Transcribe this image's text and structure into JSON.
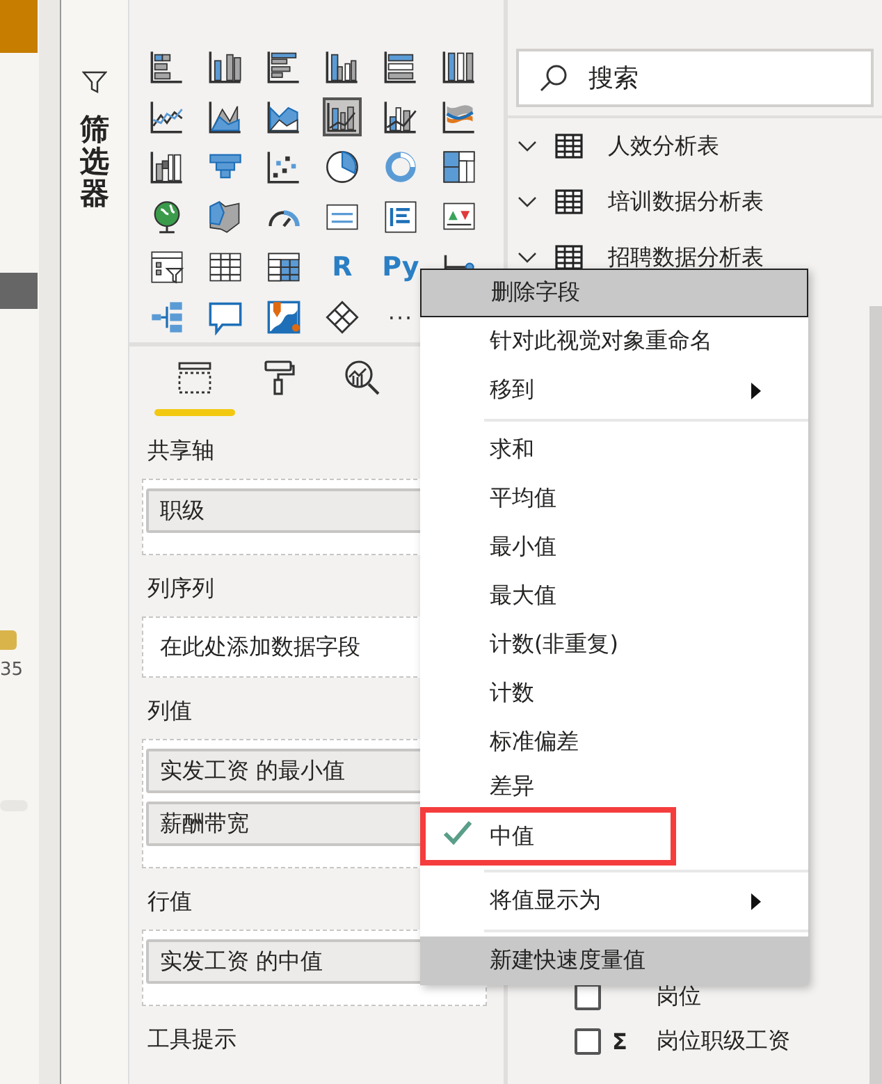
{
  "report_canvas": {
    "labels": [
      "35"
    ]
  },
  "filters_pane": {
    "title": "筛选器"
  },
  "visualizations": {
    "icons": [
      {
        "kind": "bar-stacked",
        "selected": false
      },
      {
        "kind": "column-stacked",
        "selected": false
      },
      {
        "kind": "bar-clustered",
        "selected": false
      },
      {
        "kind": "column-clustered",
        "selected": false
      },
      {
        "kind": "bar-100",
        "selected": false
      },
      {
        "kind": "column-100",
        "selected": false
      },
      {
        "kind": "line",
        "selected": false
      },
      {
        "kind": "area",
        "selected": false
      },
      {
        "kind": "area-stacked",
        "selected": false
      },
      {
        "kind": "line-column",
        "selected": true
      },
      {
        "kind": "line-column-clustered",
        "selected": false
      },
      {
        "kind": "ribbon",
        "selected": false
      },
      {
        "kind": "waterfall",
        "selected": false
      },
      {
        "kind": "funnel",
        "selected": false
      },
      {
        "kind": "scatter",
        "selected": false
      },
      {
        "kind": "pie",
        "selected": false
      },
      {
        "kind": "donut",
        "selected": false
      },
      {
        "kind": "treemap",
        "selected": false
      },
      {
        "kind": "globe",
        "selected": false
      },
      {
        "kind": "filled-map",
        "selected": false
      },
      {
        "kind": "gauge",
        "selected": false
      },
      {
        "kind": "card",
        "selected": false
      },
      {
        "kind": "multirow-card",
        "selected": false
      },
      {
        "kind": "kpi",
        "selected": false
      },
      {
        "kind": "slicer",
        "selected": false
      },
      {
        "kind": "table",
        "selected": false
      },
      {
        "kind": "matrix",
        "selected": false
      },
      {
        "kind": "text",
        "text": "R",
        "selected": false
      },
      {
        "kind": "text",
        "text": "Py",
        "selected": false
      },
      {
        "kind": "key-influencers",
        "selected": false
      },
      {
        "kind": "decomposition-tree",
        "selected": false
      },
      {
        "kind": "qa",
        "selected": false
      },
      {
        "kind": "arcgis",
        "selected": false
      },
      {
        "kind": "power-apps",
        "selected": false
      },
      {
        "kind": "more",
        "text": "···",
        "selected": false
      }
    ],
    "tabs": [
      {
        "kind": "fields",
        "selected": true
      },
      {
        "kind": "format",
        "selected": false
      },
      {
        "kind": "analytics",
        "selected": false
      }
    ],
    "wells": [
      {
        "label": "共享轴",
        "fields": [
          "职级"
        ]
      },
      {
        "label": "列序列",
        "placeholder": "在此处添加数据字段"
      },
      {
        "label": "列值",
        "fields": [
          "实发工资 的最小值",
          "薪酬带宽"
        ]
      },
      {
        "label": "行值",
        "fields": [
          "实发工资 的中值"
        ]
      },
      {
        "label": "工具提示"
      }
    ]
  },
  "fields_pane": {
    "search": {
      "placeholder": "搜索"
    },
    "tables": [
      {
        "name": "人效分析表",
        "expanded": true
      },
      {
        "name": "培训数据分析表",
        "expanded": true
      },
      {
        "name": "招聘数据分析表",
        "expanded": true
      }
    ],
    "fields": [
      {
        "name": "岗位",
        "kind": "column",
        "checked": false
      },
      {
        "name": "岗位职级工资",
        "kind": "measure",
        "symbol": "Σ",
        "checked": false
      }
    ]
  },
  "context_menu": {
    "items": [
      {
        "kind": "action",
        "label": "删除字段",
        "highlighted": true,
        "focused": true
      },
      {
        "kind": "action",
        "label": "针对此视觉对象重命名",
        "highlighted": false,
        "focused": false
      },
      {
        "kind": "submenu",
        "label": "移到",
        "highlighted": false,
        "focused": false
      },
      {
        "kind": "separator"
      },
      {
        "kind": "aggregate",
        "label": "求和",
        "checked": false,
        "outlined": false
      },
      {
        "kind": "aggregate",
        "label": "平均值",
        "checked": false,
        "outlined": false
      },
      {
        "kind": "aggregate",
        "label": "最小值",
        "checked": false,
        "outlined": false
      },
      {
        "kind": "aggregate",
        "label": "最大值",
        "checked": false,
        "outlined": false
      },
      {
        "kind": "aggregate",
        "label": "计数(非重复)",
        "checked": false,
        "outlined": false
      },
      {
        "kind": "aggregate",
        "label": "计数",
        "checked": false,
        "outlined": false
      },
      {
        "kind": "aggregate",
        "label": "标准偏差",
        "checked": false,
        "outlined": false
      },
      {
        "kind": "aggregate",
        "label": "差异",
        "checked": false,
        "outlined": false
      },
      {
        "kind": "aggregate",
        "label": "中值",
        "checked": true,
        "outlined": true
      },
      {
        "kind": "separator"
      },
      {
        "kind": "submenu",
        "label": "将值显示为",
        "highlighted": false,
        "focused": false
      },
      {
        "kind": "separator"
      },
      {
        "kind": "action",
        "label": "新建快速度量值",
        "highlighted": true,
        "focused": false
      }
    ]
  }
}
